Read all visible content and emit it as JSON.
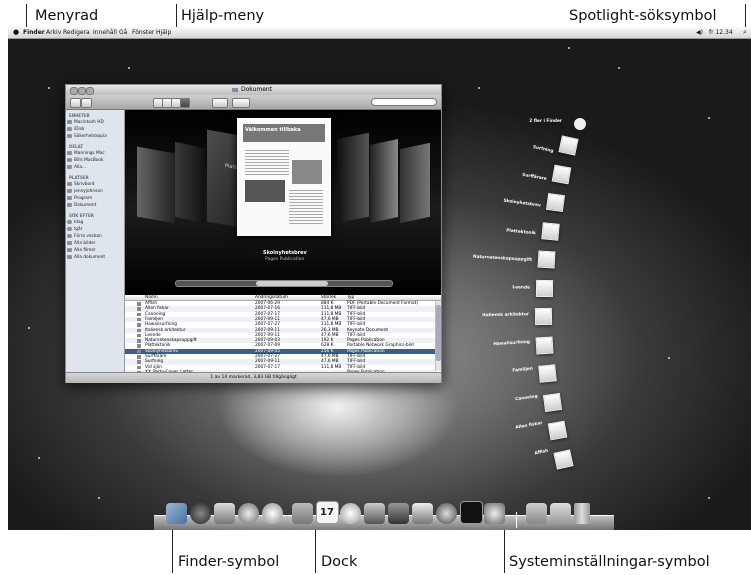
{
  "callouts": {
    "menyrad": "Menyrad",
    "hjalp": "Hjälp-meny",
    "spotlight": "Spotlight-söksymbol",
    "finder": "Finder-symbol",
    "dock": "Dock",
    "sysinst": "Systeminställningar-symbol"
  },
  "menubar": {
    "apple": "",
    "items": [
      "Finder",
      "Arkiv",
      "Redigera",
      "Innehåll",
      "Gå",
      "Fönster",
      "Hjälp"
    ],
    "clock": "fr 12.34",
    "volume": "◀)",
    "search_icon": "⌕"
  },
  "finder": {
    "title": "Dokument",
    "search_placeholder": "",
    "sidebar": {
      "enheter": {
        "header": "ENHETER",
        "items": [
          "Macintosh HD",
          "iDisk",
          "Säkerhetskopia"
        ]
      },
      "delat": {
        "header": "DELAT",
        "items": [
          "Mannings Mac",
          "Bills MacBook",
          "Alla..."
        ]
      },
      "platser": {
        "header": "PLATSER",
        "items": [
          "Skrivbord",
          "jennyjohnson",
          "Program",
          "Dokument"
        ]
      },
      "sok": {
        "header": "SÖK EFTER",
        "items": [
          "Idag",
          "Igår",
          "Förra veckan",
          "Alla bilder",
          "Alla filmer",
          "Alla dokument"
        ]
      }
    },
    "cover": {
      "doc_title": "Välkommen tillbaka",
      "caption": "Skolnyhetsbrev",
      "subcaption": "Pages Publication",
      "left_label": "Plattektonik"
    },
    "columns": [
      "Namn",
      "Ändringsdatum",
      "Storlek",
      "Typ"
    ],
    "rows": [
      {
        "name": "Affish",
        "date": "2007-06-29",
        "size": "884 K",
        "kind": "PDF (Portable Document Format)"
      },
      {
        "name": "Allen fiskar",
        "date": "2007-07-16",
        "size": "111,8 MB",
        "kind": "TIFF-bild"
      },
      {
        "name": "Canoeing",
        "date": "2007-07-17",
        "size": "111,8 MB",
        "kind": "TIFF-bild"
      },
      {
        "name": "Familjen",
        "date": "2007-09-11",
        "size": "47,6 MB",
        "kind": "TIFF-bild"
      },
      {
        "name": "Hawaiisurfning",
        "date": "2007-07-27",
        "size": "111,8 MB",
        "kind": "TIFF-bild"
      },
      {
        "name": "Italiensk arkitektur",
        "date": "2007-09-11",
        "size": "26,3 MB",
        "kind": "Keynote Document"
      },
      {
        "name": "Leende",
        "date": "2007-09-11",
        "size": "47,6 MB",
        "kind": "TIFF-bild"
      },
      {
        "name": "Naturvetenskapsuppgift",
        "date": "2007-09-03",
        "size": "192 K",
        "kind": "Pages Publication"
      },
      {
        "name": "Plattektonik",
        "date": "2007-07-09",
        "size": "628 K",
        "kind": "Portable Network Graphics-bild"
      },
      {
        "name": "Skolnyhetsbrev",
        "date": "2007-09-05",
        "size": "256 K",
        "kind": "Pages Publication"
      },
      {
        "name": "Surffärare",
        "date": "2007-07-27",
        "size": "47,6 MB",
        "kind": "TIFF-bild"
      },
      {
        "name": "Surfning",
        "date": "2007-09-11",
        "size": "47,6 MB",
        "kind": "TIFF-bild"
      },
      {
        "name": "Vid sjön",
        "date": "2007-07-17",
        "size": "111,8 MB",
        "kind": "TIFF-bild"
      },
      {
        "name": "XX_Party-Cover_Letter",
        "date": "",
        "size": "",
        "kind": "Pages Publication"
      }
    ],
    "selected_row": 9,
    "status": "1 av 14 markerad, 3,83 GB tillgängligt"
  },
  "stack": {
    "header": "2 fler i Finder",
    "items": [
      "Surfning",
      "Surffärare",
      "Skolnyhetsbrev",
      "Plattektonik",
      "Naturvetenskapsuppgift",
      "Leende",
      "Italiensk arkitektur",
      "Hawaiisurfning",
      "Familjen",
      "Canoeing",
      "Allen fiskar",
      "Affish"
    ]
  },
  "dock": {
    "calendar_day": "17",
    "icons": [
      "finder-icon",
      "dashboard-icon",
      "mail-icon",
      "safari-icon",
      "ichat-icon",
      "address-book-icon",
      "ical-icon",
      "itunes-icon",
      "iphoto-icon",
      "imovie-icon",
      "spaces-icon",
      "time-machine-icon",
      "terminal-icon",
      "system-preferences-icon",
      "documents-stack-icon",
      "downloads-stack-icon",
      "trash-icon"
    ]
  },
  "colors": {
    "selection": "#3a5f8f",
    "sidebar_bg": "#dfe5ec"
  }
}
